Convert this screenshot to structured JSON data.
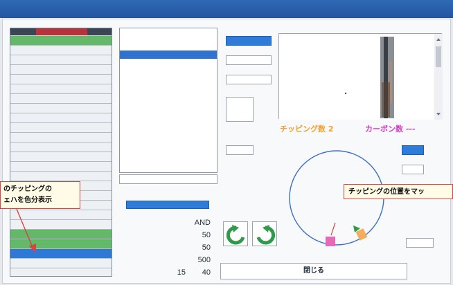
{
  "titlebar": {
    "left_title": "",
    "right_name_label": "",
    "right_name_value": "",
    "lot_label": ""
  },
  "table": {
    "rows": [
      {
        "num": "",
        "color": "green"
      },
      {
        "num": "",
        "color": "white"
      },
      {
        "num": "",
        "color": "white"
      },
      {
        "num": "",
        "color": "white"
      },
      {
        "num": "",
        "color": "white"
      },
      {
        "num": "",
        "color": "white"
      },
      {
        "num": "",
        "color": "white"
      },
      {
        "num": "",
        "color": "white"
      },
      {
        "num": "",
        "color": "white"
      },
      {
        "num": "",
        "color": "white"
      },
      {
        "num": "",
        "color": "white"
      },
      {
        "num": "",
        "color": "white"
      },
      {
        "num": "",
        "color": "white"
      },
      {
        "num": "",
        "color": "white"
      },
      {
        "num": "",
        "color": "white"
      },
      {
        "num": "",
        "color": "white"
      },
      {
        "num": "",
        "color": "white"
      },
      {
        "num": "",
        "color": "white"
      },
      {
        "num": "",
        "color": "white"
      },
      {
        "num": "",
        "color": "white"
      },
      {
        "num": "",
        "color": "green"
      },
      {
        "num": "",
        "color": "green"
      },
      {
        "num": "",
        "color": "blue"
      },
      {
        "num": "",
        "color": "white"
      },
      {
        "num": "",
        "color": "white"
      }
    ]
  },
  "time_panel": {
    "header_line1": "",
    "header_line2": "",
    "selected_time": ""
  },
  "delete_button": "",
  "params": {
    "section_title": "",
    "load_button": "",
    "rows": [
      {
        "key": "",
        "value": "AND"
      },
      {
        "key": "",
        "value": "50"
      },
      {
        "key": "",
        "value": "50"
      },
      {
        "key": "",
        "value": "500"
      },
      {
        "key": "",
        "value_a": "15",
        "value_b": "40"
      }
    ]
  },
  "result": {
    "section_title": "",
    "blue_button": "",
    "hide_button": "",
    "abnormal_button": "",
    "x_label": "",
    "y_label": "",
    "chipping_label": "",
    "area_label": "",
    "chipping_count_text": "チッピング数 2",
    "carbon_count_text": "カーボン数 ---",
    "image_caption": ""
  },
  "feedback": {
    "section_title": "",
    "recheck_button": ""
  },
  "side_buttons": {
    "top": "",
    "second": ""
  },
  "wafer_label": "",
  "close_button": "閉じる",
  "save_image_button": "",
  "callouts": {
    "left_line1": "のチッピングの",
    "left_line2": "ェハを色分表示",
    "right": "チッピングの位置をマッ"
  },
  "colors": {
    "accent_blue": "#2f7bd8",
    "chip_pink": "#e66ab8",
    "chip_orange": "#f2ae5c",
    "green_arrow": "#2e9a4a",
    "orange_text": "#f0a030",
    "magenta_text": "#d43cc4"
  }
}
